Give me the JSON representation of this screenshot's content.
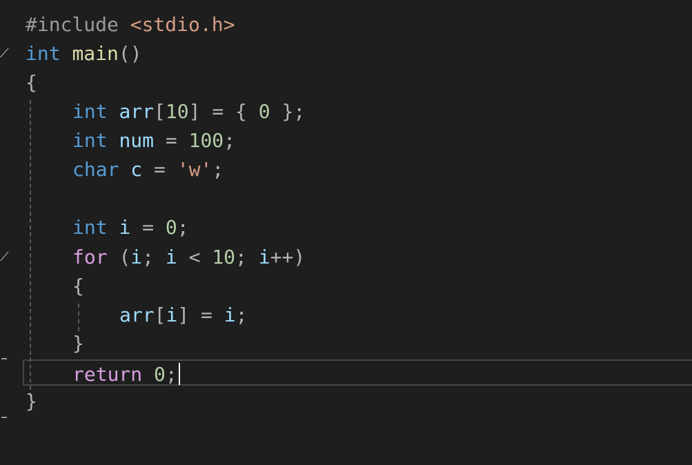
{
  "editor": {
    "language": "C",
    "lines": {
      "l1": {
        "directive": "#include",
        "header": "<stdio.h>"
      },
      "l2": {
        "type": "int",
        "name": "main",
        "parens": "()"
      },
      "l3": {
        "brace": "{"
      },
      "l4": {
        "type": "int",
        "var": "arr",
        "b1": "[",
        "size": "10",
        "b2": "]",
        "eq": "=",
        "o": "{",
        "init": "0",
        "c": "};"
      },
      "l5": {
        "type": "int",
        "var": "num",
        "eq": "=",
        "val": "100",
        "semi": ";"
      },
      "l6": {
        "type": "char",
        "var": "c",
        "eq": "=",
        "q1": "'",
        "ch": "w",
        "q2": "'",
        "semi": ";"
      },
      "l8": {
        "type": "int",
        "var": "i",
        "eq": "=",
        "val": "0",
        "semi": ";"
      },
      "l9": {
        "kw": "for",
        "p1": "(",
        "v1": "i",
        "s1": ";",
        "v2": "i",
        "lt": "<",
        "n": "10",
        "s2": ";",
        "v3": "i",
        "pp": "++)"
      },
      "l10": {
        "brace": "{"
      },
      "l11": {
        "var": "arr",
        "b1": "[",
        "idx": "i",
        "b2": "]",
        "eq": "=",
        "v": "i",
        "semi": ";"
      },
      "l12": {
        "brace": "}"
      },
      "l13": {
        "kw": "return",
        "val": "0",
        "semi": ";"
      },
      "l14": {
        "brace": "}"
      }
    },
    "colors": {
      "background": "#1e1e1e",
      "keyword": "#569cd6",
      "control": "#d8a0df",
      "function": "#dcdcaa",
      "variable": "#9cdcfe",
      "number": "#b5cea8",
      "string": "#d69d85"
    },
    "fold_icon": "fold-collapse-icon"
  }
}
